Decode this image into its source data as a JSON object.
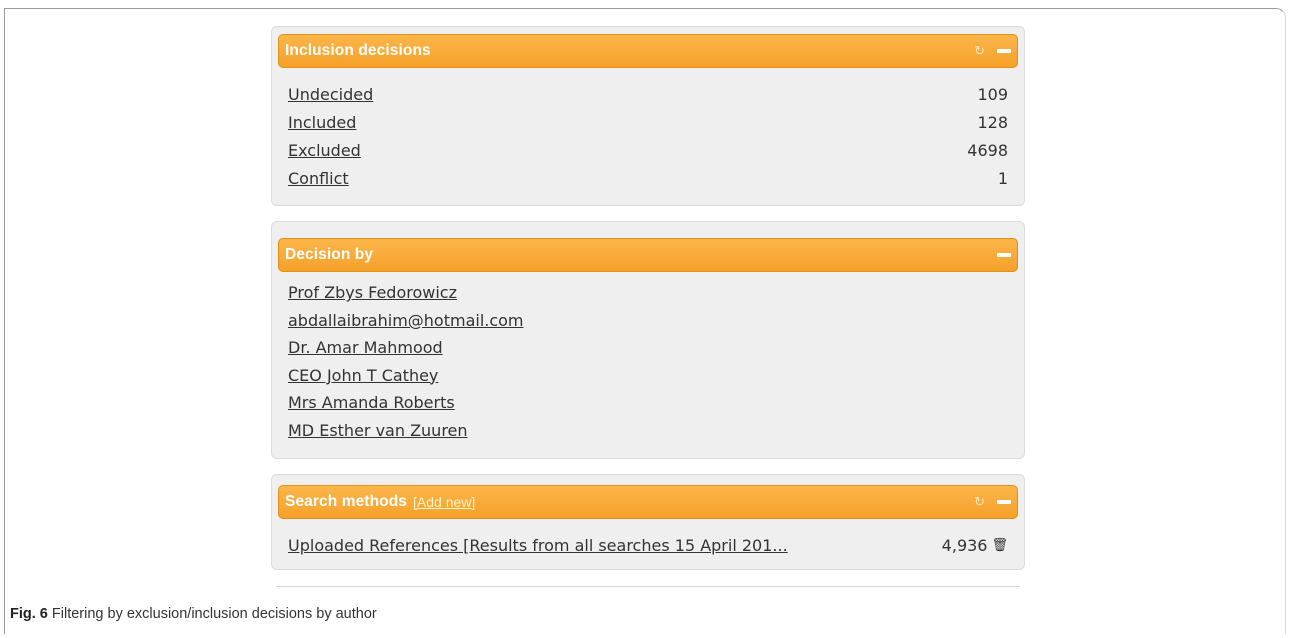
{
  "inclusion": {
    "title": "Inclusion decisions",
    "rows": [
      {
        "label": "Undecided",
        "count": "109"
      },
      {
        "label": "Included",
        "count": "128"
      },
      {
        "label": "Excluded",
        "count": "4698"
      },
      {
        "label": "Conflict",
        "count": "1"
      }
    ]
  },
  "decision_by": {
    "title": "Decision by",
    "names": [
      "Prof Zbys Fedorowicz",
      "abdallaibrahim@hotmail.com",
      "Dr. Amar Mahmood",
      "CEO John T Cathey",
      "Mrs Amanda Roberts",
      "MD Esther van Zuuren"
    ]
  },
  "search_methods": {
    "title": "Search methods",
    "add_new": "[Add new]",
    "item_label": "Uploaded References [Results from all searches 15 April 201...",
    "item_count": "4,936"
  },
  "icons": {
    "refresh": "refresh-icon",
    "collapse": "collapse-icon",
    "trash": "trash-icon"
  },
  "caption": {
    "label": "Fig. 6",
    "text": " Filtering by exclusion/inclusion decisions by author"
  }
}
